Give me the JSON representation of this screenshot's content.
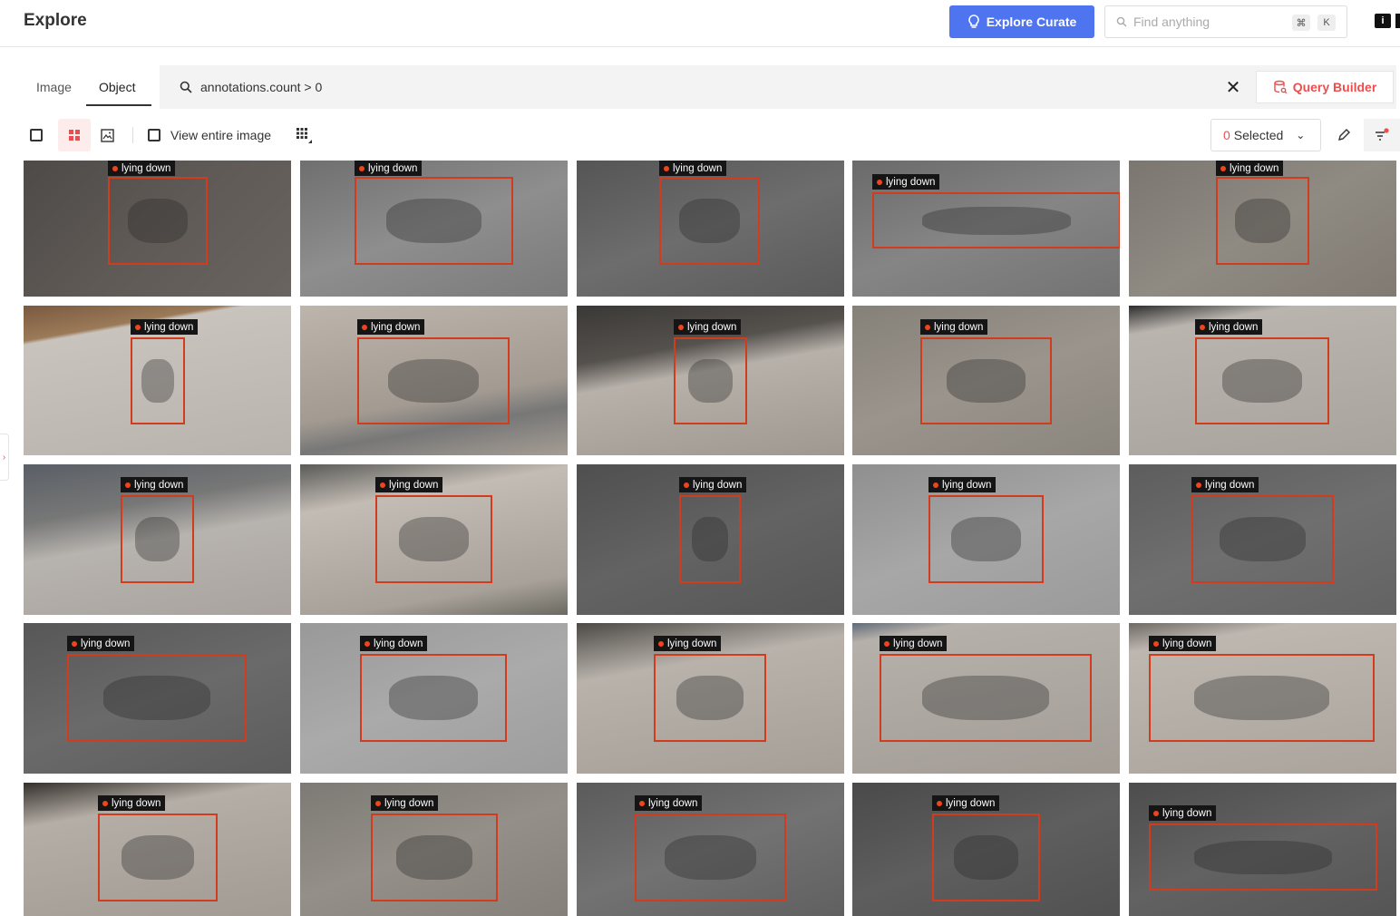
{
  "header": {
    "title": "Explore",
    "curate_label": "Explore Curate",
    "search_placeholder": "Find anything",
    "kbd_mod": "⌘",
    "kbd_key": "K",
    "info_glyph": "i"
  },
  "tabs": [
    {
      "label": "Image",
      "active": false
    },
    {
      "label": "Object",
      "active": true
    }
  ],
  "query": {
    "text": "annotations.count > 0",
    "clear_glyph": "✕",
    "builder_label": "Query Builder"
  },
  "toolbar": {
    "view_entire_label": "View entire image",
    "selected_count": "0",
    "selected_label": "Selected",
    "chevron": "⌄"
  },
  "sidebar_toggle_glyph": "›",
  "colors": {
    "accent_blue": "#4f74f0",
    "accent_red": "#ec4e4e",
    "bbox": "#d23c1c"
  },
  "grid": {
    "label": "lying down",
    "cells": [
      {
        "bg": "linear-gradient(135deg,#4d4a48,#5f5a55 50%,#6a6460)",
        "bbox": true
      },
      {
        "bg": "linear-gradient(160deg,#6f6f6f,#8e8e8e 50%,#7a7a7a)"
      },
      {
        "bg": "linear-gradient(160deg,#555,#6d6d6d 50%,#5a5a5a)"
      },
      {
        "bg": "linear-gradient(160deg,#6a6a6a,#858585 50%,#737373)"
      },
      {
        "bg": "linear-gradient(150deg,#7b7670,#8f8a82 50%,#807a73)"
      },
      {
        "bg": "linear-gradient(170deg,#7a5a40 0,#9b7a58 18%,#c9c3bd 20%,#b9b3ad 100%)"
      },
      {
        "bg": "linear-gradient(170deg,#bdb5ac,#a39b92 60%,#777 75%,#a59d94)"
      },
      {
        "bg": "linear-gradient(170deg,#3a3836 0,#55514d 30%,#b7b1aa 45%,#9f9890)"
      },
      {
        "bg": "linear-gradient(160deg,#858078,#9a948c 50%,#8a857d)"
      },
      {
        "bg": "linear-gradient(170deg,#2d2d2d 0,#b9b4ae 15%,#a9a39d)"
      },
      {
        "bg": "linear-gradient(170deg,#5a5f66 0,#777 30%,#b7b3ae 50%,#a8a39e)"
      },
      {
        "bg": "linear-gradient(170deg,#5a5a58 0,#c3bcb4 25%,#a8a199 80%,#6a6a60)"
      },
      {
        "bg": "linear-gradient(160deg,#4f4f4f,#636363 50%,#565656)"
      },
      {
        "bg": "linear-gradient(160deg,#8f8f8f,#a7a7a7 50%,#9a9a9a)"
      },
      {
        "bg": "linear-gradient(160deg,#5d5d5d,#6f6f6f 50%,#636363)"
      },
      {
        "bg": "linear-gradient(160deg,#575757,#6a6a6a 50%,#5c5c5c)"
      },
      {
        "bg": "linear-gradient(160deg,#999,#aaa 50%,#9d9d9d)"
      },
      {
        "bg": "linear-gradient(170deg,#4c4a46 0,#b8b2ab 30%,#a59f98)"
      },
      {
        "bg": "linear-gradient(170deg,#5f6a78 0,#b5b0aa 10%,#a39d96)"
      },
      {
        "bg": "linear-gradient(170deg,#6f6a64 0,#bdb7b0 15%,#aaa49d)"
      },
      {
        "bg": "linear-gradient(170deg,#34302c 0,#b5aea6 25%,#a29b93)"
      },
      {
        "bg": "linear-gradient(160deg,#7d7a75,#948f88 50%,#85807a)"
      },
      {
        "bg": "linear-gradient(160deg,#5b5b5b,#727272 50%,#606060)"
      },
      {
        "bg": "linear-gradient(160deg,#4a4a4a,#5e5e5e 50%,#515151)"
      },
      {
        "bg": "linear-gradient(160deg,#4d4d4d,#626262 50%,#555)"
      }
    ]
  }
}
